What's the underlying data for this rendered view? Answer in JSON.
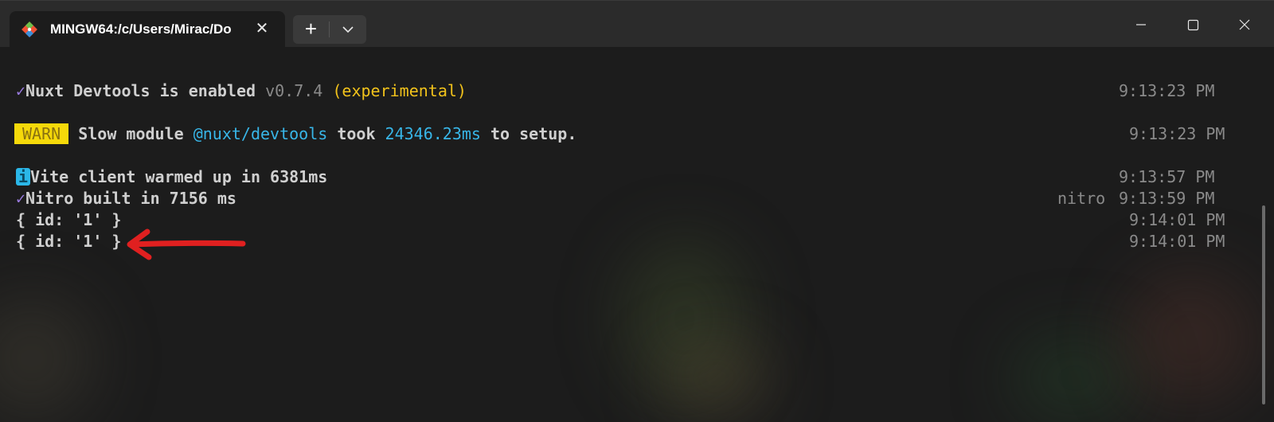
{
  "window": {
    "tab_title": "MINGW64:/c/Users/Mirac/Do",
    "tab_icon": "git-bash-icon",
    "new_tab_glyph": "+",
    "close_glyph": "✕"
  },
  "terminal": {
    "lines": [
      {
        "check": "✓",
        "text": "Nuxt Devtools is enabled ",
        "version": "v0.7.4",
        "tag": " (experimental)",
        "timestamp": "9:13:23 PM"
      },
      {
        "badge": "WARN",
        "pre": " Slow module ",
        "module": "@nuxt/devtools",
        "mid": " took ",
        "duration": "24346.23ms",
        "post": " to setup.",
        "timestamp": "9:13:23 PM"
      },
      {
        "badge": "i",
        "text": "Vite client warmed up in 6381ms",
        "timestamp": "9:13:57 PM"
      },
      {
        "check": "✓",
        "text": "Nitro built in 7156 ms",
        "tag": "nitro",
        "timestamp": "9:13:59 PM"
      },
      {
        "text": "{ id: '1' }",
        "timestamp": "9:14:01 PM"
      },
      {
        "text": "{ id: '1' }",
        "timestamp": "9:14:01 PM"
      }
    ]
  },
  "colors": {
    "check": "#9a7be0",
    "warn": "#f5d90a",
    "info": "#2bb7e8",
    "yellow": "#f1c21b",
    "cyan": "#38b6e8",
    "annotation_arrow": "#e02020"
  }
}
